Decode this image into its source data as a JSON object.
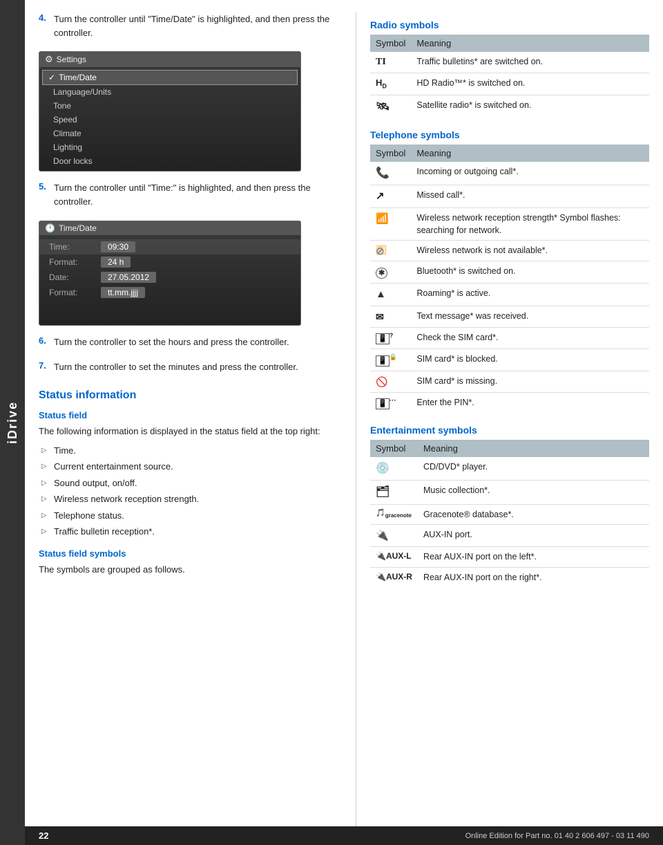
{
  "sidebar": {
    "label": "iDrive"
  },
  "left": {
    "steps": [
      {
        "num": "4.",
        "text": "Turn the controller until \"Time/Date\" is highlighted, and then press the controller."
      },
      {
        "num": "5.",
        "text": "Turn the controller until \"Time:\" is highlighted, and then press the controller."
      },
      {
        "num": "6.",
        "text": "Turn the controller to set the hours and press the controller."
      },
      {
        "num": "7.",
        "text": "Turn the controller to set the minutes and press the controller."
      }
    ],
    "screen1": {
      "title": "Settings",
      "items": [
        "Time/Date",
        "Language/Units",
        "Tone",
        "Speed",
        "Climate",
        "Lighting",
        "Door locks"
      ]
    },
    "screen2": {
      "title": "Time/Date",
      "rows": [
        {
          "label": "Time:",
          "value": "09:30"
        },
        {
          "label": "Format:",
          "value": "24 h"
        },
        {
          "label": "Date:",
          "value": "27.05.2012"
        },
        {
          "label": "Format:",
          "value": "tt.mm.jjjj"
        }
      ]
    },
    "status_section": "Status information",
    "status_field_heading": "Status field",
    "status_field_body": "The following information is displayed in the status field at the top right:",
    "status_bullets": [
      "Time.",
      "Current entertainment source.",
      "Sound output, on/off.",
      "Wireless network reception strength.",
      "Telephone status.",
      "Traffic bulletin reception*."
    ],
    "status_field_symbols_heading": "Status field symbols",
    "status_field_symbols_body": "The symbols are grouped as follows."
  },
  "right": {
    "radio_section": "Radio symbols",
    "radio_table_headers": [
      "Symbol",
      "Meaning"
    ],
    "radio_rows": [
      {
        "symbol": "TI",
        "meaning": "Traffic bulletins* are switched on."
      },
      {
        "symbol": "HD",
        "meaning": "HD Radio™* is switched on."
      },
      {
        "symbol": "🛰",
        "meaning": "Satellite radio* is switched on."
      }
    ],
    "telephone_section": "Telephone symbols",
    "telephone_table_headers": [
      "Symbol",
      "Meaning"
    ],
    "telephone_rows": [
      {
        "symbol": "📞",
        "meaning": "Incoming or outgoing call*."
      },
      {
        "symbol": "↗",
        "meaning": "Missed call*."
      },
      {
        "symbol": "📶",
        "meaning": "Wireless network reception strength* Symbol flashes: searching for network."
      },
      {
        "symbol": "📶̶",
        "meaning": "Wireless network is not available*."
      },
      {
        "symbol": "🔵",
        "meaning": "Bluetooth* is switched on."
      },
      {
        "symbol": "▲",
        "meaning": "Roaming* is active."
      },
      {
        "symbol": "✉",
        "meaning": "Text message* was received."
      },
      {
        "symbol": "📱",
        "meaning": "Check the SIM card*."
      },
      {
        "symbol": "🔒",
        "meaning": "SIM card* is blocked."
      },
      {
        "symbol": "⊘",
        "meaning": "SIM card* is missing."
      },
      {
        "symbol": "🔢",
        "meaning": "Enter the PIN*."
      }
    ],
    "entertainment_section": "Entertainment symbols",
    "entertainment_table_headers": [
      "Symbol",
      "Meaning"
    ],
    "entertainment_rows": [
      {
        "symbol": "💿",
        "meaning": "CD/DVD* player."
      },
      {
        "symbol": "🗂",
        "meaning": "Music collection*."
      },
      {
        "symbol": "🎵gracenote",
        "meaning": "Gracenote® database*."
      },
      {
        "symbol": "🔌",
        "meaning": "AUX-IN port."
      },
      {
        "symbol": "🔌AUX-L",
        "meaning": "Rear AUX-IN port on the left*."
      },
      {
        "symbol": "🔌AUX-R",
        "meaning": "Rear AUX-IN port on the right*."
      }
    ]
  },
  "footer": {
    "page": "22",
    "text": "Online Edition for Part no. 01 40 2 606 497 - 03 11 490"
  }
}
